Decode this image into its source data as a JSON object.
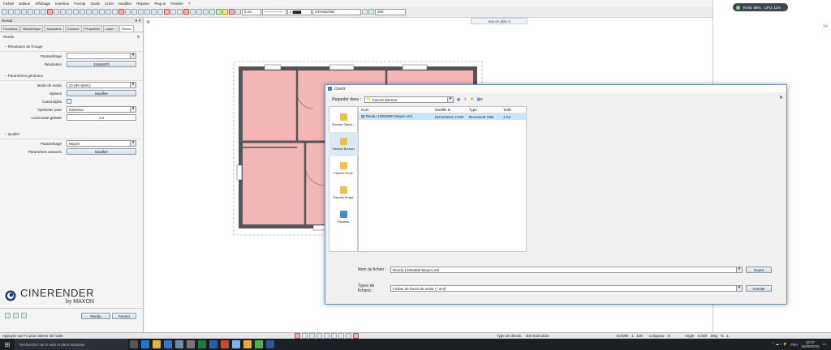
{
  "menubar": [
    "Fichier",
    "Edition",
    "Affichage",
    "Insertion",
    "Format",
    "Outils",
    "Créer",
    "Modifier",
    "Répéter",
    "Plug-in",
    "Fenêtre",
    "?"
  ],
  "toolbar": {
    "pen_value": "0.18",
    "layer_value": "1",
    "style_value": "STANDARD",
    "scale_value": "300",
    "tooltip": "Vue en plan 3"
  },
  "system_widget": {
    "ram": "RAM: 68%",
    "cpu": "CPU: 11%"
  },
  "panel": {
    "title": "Rendu",
    "close_symbol": "▾ ✕",
    "tabs": [
      "Fonctions",
      "Bibliothèque",
      "Assistants",
      "Connect",
      "Propriétés",
      "Layer...",
      "Rendu"
    ],
    "section_label": "Rendu",
    "group_resolution": "Résolution de l'image",
    "parametrage_label": "Paramétrage",
    "parametrage_value": "",
    "resolution_label": "Résolution",
    "resolution_button": "1166x870",
    "group_general": "Paramètres généraux",
    "mode_label": "Mode de rendu",
    "mode_value": "GI (IR+QMC)",
    "options_label": "Options",
    "options_button": "Modifier",
    "canal_label": "Canal alpha",
    "optimiser_label": "Optimiser pour",
    "optimiser_value": "Extérieur",
    "lum_label": "Luminosité globale",
    "lum_value": "1.0",
    "group_qualite": "Qualité",
    "qualite_param_label": "Paramétrage",
    "qualite_param_value": "Moyen",
    "avances_label": "Paramètres avancés",
    "avances_button": "Modifier",
    "logo_text": "CINERENDER",
    "logo_sub": "by MAXON",
    "rendu_button": "Rendu",
    "fermer_button": "Fermer"
  },
  "dialog": {
    "title": "Ouvrir",
    "lookin_label": "Regarder dans :",
    "lookin_value": "Favoris Bureau",
    "columns": [
      "Nom",
      "Modifié le",
      "Type",
      "Taille"
    ],
    "files": [
      {
        "name": "Rendu 1200x800 Moyen.xml",
        "date": "01/12/2014 13:08",
        "type": "Document XML",
        "size": "1 Ko"
      }
    ],
    "places": [
      {
        "label": "Favoris Stand...",
        "icon": "folder-icon"
      },
      {
        "label": "Favoris Bureau",
        "icon": "folder-icon"
      },
      {
        "label": "Favoris Privé",
        "icon": "folder-icon"
      },
      {
        "label": "Favoris Projet",
        "icon": "folder-icon"
      },
      {
        "label": "Réseau",
        "icon": "network-icon"
      }
    ],
    "filename_label": "Nom du fichier :",
    "filename_value": "Rendu 1200x800 Moyen.xml",
    "filetype_label": "Types de fichiers :",
    "filetype_value": "Fichier de favori de rendu (*.xml)",
    "open_button": "Ouvrir",
    "cancel_button": "Annuler"
  },
  "status": {
    "left": "Appuyez sur F1 pour obtenir de l'aide.",
    "drawing_type_label": "Type de dessin :",
    "drawing_type_value": "304-Exécution",
    "scale": "Echelle : 1 : 100",
    "length": "Longueur : m",
    "angle_label": "Angle :",
    "angle_value": "0.000",
    "angle_unit": "Deg",
    "percent": "% : 1"
  },
  "taskbar": {
    "search_placeholder": "Rechercher sur le web et dans Windows",
    "language": "FRA",
    "time": "12:07",
    "date": "15/09/2015"
  }
}
